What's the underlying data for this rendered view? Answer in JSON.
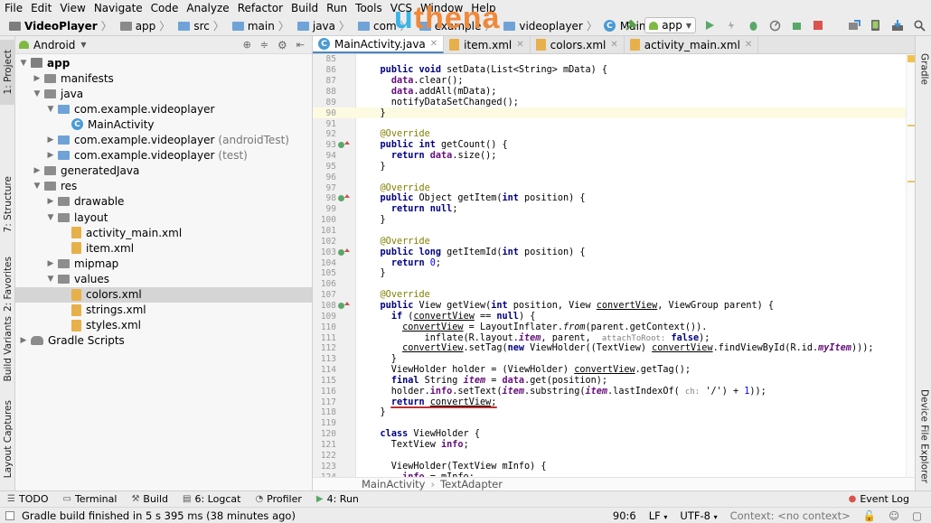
{
  "menu": [
    "File",
    "Edit",
    "View",
    "Navigate",
    "Code",
    "Analyze",
    "Refactor",
    "Build",
    "Run",
    "Tools",
    "VCS",
    "Window",
    "Help"
  ],
  "watermark": {
    "text": "uthena",
    "color_u": "#3ab4e8",
    "color_rest": "#f0883a"
  },
  "breadcrumb": [
    "VideoPlayer",
    "app",
    "src",
    "main",
    "java",
    "com",
    "example",
    "videoplayer",
    "MainActivity"
  ],
  "toolbar": {
    "config_label": "app"
  },
  "left_strip": {
    "project": "1: Project",
    "structure": "7: Structure",
    "favorites": "2: Favorites",
    "build_variants": "Build Variants",
    "layout_captures": "Layout Captures"
  },
  "right_strip": {
    "gradle": "Gradle",
    "device_explorer": "Device File Explorer"
  },
  "project_panel": {
    "view_mode": "Android",
    "tree": [
      {
        "label": "app",
        "depth": 0,
        "icon": "module",
        "arrow": "down"
      },
      {
        "label": "manifests",
        "depth": 1,
        "icon": "folder",
        "arrow": "right"
      },
      {
        "label": "java",
        "depth": 1,
        "icon": "folder",
        "arrow": "down"
      },
      {
        "label": "com.example.videoplayer",
        "depth": 2,
        "icon": "folder",
        "arrow": "down"
      },
      {
        "label": "MainActivity",
        "depth": 3,
        "icon": "class",
        "arrow": ""
      },
      {
        "label": "com.example.videoplayer",
        "suffix": "(androidTest)",
        "depth": 2,
        "icon": "folder",
        "arrow": "right"
      },
      {
        "label": "com.example.videoplayer",
        "suffix": "(test)",
        "depth": 2,
        "icon": "folder",
        "arrow": "right"
      },
      {
        "label": "generatedJava",
        "depth": 1,
        "icon": "folder",
        "arrow": "right"
      },
      {
        "label": "res",
        "depth": 1,
        "icon": "folder",
        "arrow": "down"
      },
      {
        "label": "drawable",
        "depth": 2,
        "icon": "folder",
        "arrow": "right"
      },
      {
        "label": "layout",
        "depth": 2,
        "icon": "folder",
        "arrow": "down"
      },
      {
        "label": "activity_main.xml",
        "depth": 3,
        "icon": "xml",
        "arrow": ""
      },
      {
        "label": "item.xml",
        "depth": 3,
        "icon": "xml",
        "arrow": ""
      },
      {
        "label": "mipmap",
        "depth": 2,
        "icon": "folder",
        "arrow": "right"
      },
      {
        "label": "values",
        "depth": 2,
        "icon": "folder",
        "arrow": "down"
      },
      {
        "label": "colors.xml",
        "depth": 3,
        "icon": "xml",
        "arrow": "",
        "selected": true
      },
      {
        "label": "strings.xml",
        "depth": 3,
        "icon": "xml",
        "arrow": ""
      },
      {
        "label": "styles.xml",
        "depth": 3,
        "icon": "xml",
        "arrow": ""
      },
      {
        "label": "Gradle Scripts",
        "depth": 0,
        "icon": "gradle",
        "arrow": "right"
      }
    ]
  },
  "editor_tabs": [
    {
      "label": "MainActivity.java",
      "active": true
    },
    {
      "label": "item.xml"
    },
    {
      "label": "colors.xml"
    },
    {
      "label": "activity_main.xml"
    }
  ],
  "code_lines": [
    {
      "n": "85",
      "t": ""
    },
    {
      "n": "86",
      "t": "    public void setData(List<String> mData) {"
    },
    {
      "n": "87",
      "t": "      data.clear();"
    },
    {
      "n": "88",
      "t": "      data.addAll(mData);"
    },
    {
      "n": "89",
      "t": "      notifyDataSetChanged();"
    },
    {
      "n": "90",
      "t": "    }",
      "caret": true
    },
    {
      "n": "91",
      "t": ""
    },
    {
      "n": "92",
      "t": "    @Override"
    },
    {
      "n": "93",
      "t": "    public int getCount() {",
      "mark": true
    },
    {
      "n": "94",
      "t": "      return data.size();"
    },
    {
      "n": "95",
      "t": "    }"
    },
    {
      "n": "96",
      "t": ""
    },
    {
      "n": "97",
      "t": "    @Override"
    },
    {
      "n": "98",
      "t": "    public Object getItem(int position) {",
      "mark": true
    },
    {
      "n": "99",
      "t": "      return null;"
    },
    {
      "n": "100",
      "t": "    }"
    },
    {
      "n": "101",
      "t": ""
    },
    {
      "n": "102",
      "t": "    @Override"
    },
    {
      "n": "103",
      "t": "    public long getItemId(int position) {",
      "mark": true
    },
    {
      "n": "104",
      "t": "      return 0;"
    },
    {
      "n": "105",
      "t": "    }"
    },
    {
      "n": "106",
      "t": ""
    },
    {
      "n": "107",
      "t": "    @Override"
    },
    {
      "n": "108",
      "t": "    public View getView(int position, View convertView, ViewGroup parent) {",
      "mark": true
    },
    {
      "n": "109",
      "t": "      if (convertView == null) {"
    },
    {
      "n": "110",
      "t": "        convertView = LayoutInflater.from(parent.getContext())."
    },
    {
      "n": "111",
      "t": "            inflate(R.layout.item, parent,  attachToRoot: false);"
    },
    {
      "n": "112",
      "t": "        convertView.setTag(new ViewHolder((TextView) convertView.findViewById(R.id.myItem)));"
    },
    {
      "n": "113",
      "t": "      }"
    },
    {
      "n": "114",
      "t": "      ViewHolder holder = (ViewHolder) convertView.getTag();"
    },
    {
      "n": "115",
      "t": "      final String item = data.get(position);"
    },
    {
      "n": "116",
      "t": "      holder.info.setText(item.substring(item.lastIndexOf( ch: '/') + 1));"
    },
    {
      "n": "117",
      "t": "      return convertView;",
      "underline": true
    },
    {
      "n": "118",
      "t": "    }"
    },
    {
      "n": "119",
      "t": ""
    },
    {
      "n": "120",
      "t": "    class ViewHolder {"
    },
    {
      "n": "121",
      "t": "      TextView info;"
    },
    {
      "n": "122",
      "t": ""
    },
    {
      "n": "123",
      "t": "      ViewHolder(TextView mInfo) {"
    },
    {
      "n": "124",
      "t": "        info = mInfo;"
    }
  ],
  "editor_breadcrumb": [
    "MainActivity",
    "TextAdapter"
  ],
  "tool_windows": [
    {
      "label": "TODO",
      "icon": "list-icon"
    },
    {
      "label": "Terminal",
      "icon": "terminal-icon"
    },
    {
      "label": "Build",
      "icon": "hammer-icon"
    },
    {
      "label": "6: Logcat",
      "icon": "logcat-icon"
    },
    {
      "label": "Profiler",
      "icon": "profiler-icon"
    },
    {
      "label": "4: Run",
      "icon": "run-icon"
    }
  ],
  "event_log": "Event Log",
  "status": {
    "message": "Gradle build finished in 5 s 395 ms (38 minutes ago)",
    "position": "90:6",
    "line_sep": "LF",
    "encoding": "UTF-8",
    "context": "Context: <no context>"
  },
  "colors": {
    "keyword": "#000080",
    "field": "#660e7a",
    "annotation": "#808000",
    "number": "#0000ff",
    "hint": "#808080",
    "accent": "#4a88c7",
    "underline": "#c0302c"
  }
}
